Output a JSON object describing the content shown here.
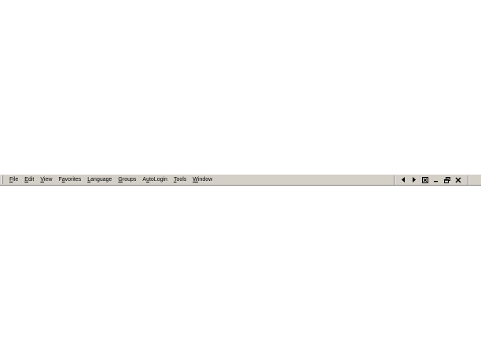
{
  "menubar": {
    "items": [
      {
        "pre": "",
        "u": "F",
        "post": "ile"
      },
      {
        "pre": "",
        "u": "E",
        "post": "dit"
      },
      {
        "pre": "",
        "u": "V",
        "post": "iew"
      },
      {
        "pre": "F",
        "u": "a",
        "post": "vorites"
      },
      {
        "pre": "",
        "u": "L",
        "post": "anguage"
      },
      {
        "pre": "",
        "u": "G",
        "post": "roups"
      },
      {
        "pre": "A",
        "u": "u",
        "post": "toLogin"
      },
      {
        "pre": "",
        "u": "T",
        "post": "ools"
      },
      {
        "pre": "",
        "u": "W",
        "post": "indow"
      }
    ]
  },
  "controls": {
    "prev_icon": "triangle-left-icon",
    "next_icon": "triangle-right-icon",
    "close_tab_icon": "boxed-x-icon",
    "minimize_icon": "minimize-icon",
    "restore_icon": "restore-icon",
    "close_icon": "close-icon"
  },
  "colors": {
    "menubar_bg": "#d4d0c8",
    "text": "#000000"
  }
}
